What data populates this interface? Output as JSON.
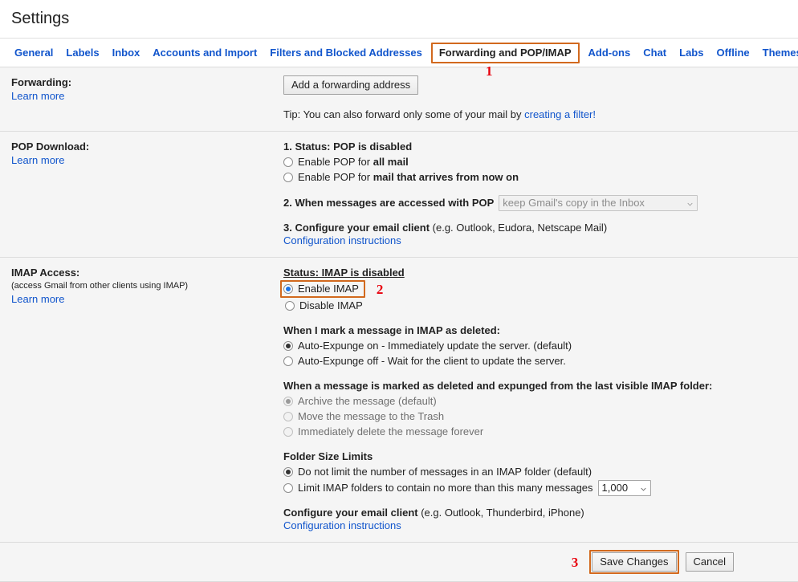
{
  "header": {
    "title": "Settings"
  },
  "tabs": [
    {
      "label": "General",
      "active": false
    },
    {
      "label": "Labels",
      "active": false
    },
    {
      "label": "Inbox",
      "active": false
    },
    {
      "label": "Accounts and Import",
      "active": false
    },
    {
      "label": "Filters and Blocked Addresses",
      "active": false
    },
    {
      "label": "Forwarding and POP/IMAP",
      "active": true
    },
    {
      "label": "Add-ons",
      "active": false
    },
    {
      "label": "Chat",
      "active": false
    },
    {
      "label": "Labs",
      "active": false
    },
    {
      "label": "Offline",
      "active": false
    },
    {
      "label": "Themes",
      "active": false
    }
  ],
  "annotations": {
    "step1": "1",
    "step2": "2",
    "step3": "3",
    "highlight_color": "#d2691e",
    "number_color": "#e8000d"
  },
  "forwarding": {
    "section_label": "Forwarding:",
    "learn_more": "Learn more",
    "add_address_button": "Add a forwarding address",
    "tip_prefix": "Tip: You can also forward only some of your mail by ",
    "tip_link": "creating a filter!"
  },
  "pop": {
    "section_label": "POP Download:",
    "learn_more": "Learn more",
    "step1_status": "1. Status: POP is disabled",
    "option_all_prefix": "Enable POP for ",
    "option_all_bold": "all mail",
    "option_now_prefix": "Enable POP for ",
    "option_now_bold": "mail that arrives from now on",
    "step2_label": "2. When messages are accessed with POP",
    "step2_select_value": "keep Gmail's copy in the Inbox",
    "step3_label_bold": "3. Configure your email client",
    "step3_label_rest": " (e.g. Outlook, Eudora, Netscape Mail)",
    "config_link": "Configuration instructions"
  },
  "imap": {
    "section_label": "IMAP Access:",
    "section_note": "(access Gmail from other clients using IMAP)",
    "learn_more": "Learn more",
    "status": "Status: IMAP is disabled",
    "enable_label": "Enable IMAP",
    "disable_label": "Disable IMAP",
    "expunge_heading": "When I mark a message in IMAP as deleted:",
    "expunge_on": "Auto-Expunge on - Immediately update the server. (default)",
    "expunge_off": "Auto-Expunge off - Wait for the client to update the server.",
    "deleted_heading": "When a message is marked as deleted and expunged from the last visible IMAP folder:",
    "deleted_archive": "Archive the message (default)",
    "deleted_trash": "Move the message to the Trash",
    "deleted_forever": "Immediately delete the message forever",
    "folder_limits_heading": "Folder Size Limits",
    "folder_nolimit": "Do not limit the number of messages in an IMAP folder (default)",
    "folder_limit_prefix": "Limit IMAP folders to contain no more than this many messages",
    "folder_limit_value": "1,000",
    "configure_bold": "Configure your email client",
    "configure_rest": " (e.g. Outlook, Thunderbird, iPhone)",
    "config_link": "Configuration instructions"
  },
  "footer": {
    "save_label": "Save Changes",
    "cancel_label": "Cancel"
  }
}
